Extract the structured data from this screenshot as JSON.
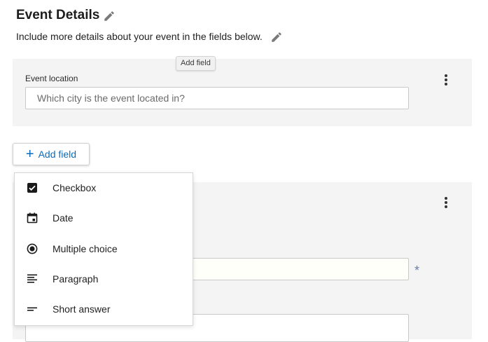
{
  "header": {
    "title": "Event Details",
    "description": "Include more details about your event in the fields below."
  },
  "tooltip": {
    "text": "Add field"
  },
  "location_field": {
    "label": "Event location",
    "placeholder": "Which city is the event located in?"
  },
  "add_field_button": {
    "label": "Add field"
  },
  "required_marker": "*",
  "menu": {
    "items": [
      {
        "label": "Checkbox",
        "icon": "checkbox-checked-icon"
      },
      {
        "label": "Date",
        "icon": "calendar-icon"
      },
      {
        "label": "Multiple choice",
        "icon": "radio-icon"
      },
      {
        "label": "Paragraph",
        "icon": "paragraph-lines-icon"
      },
      {
        "label": "Short answer",
        "icon": "short-answer-icon"
      }
    ]
  },
  "colors": {
    "accent": "#0b6bb8",
    "card_bg": "#f4f4f4"
  }
}
